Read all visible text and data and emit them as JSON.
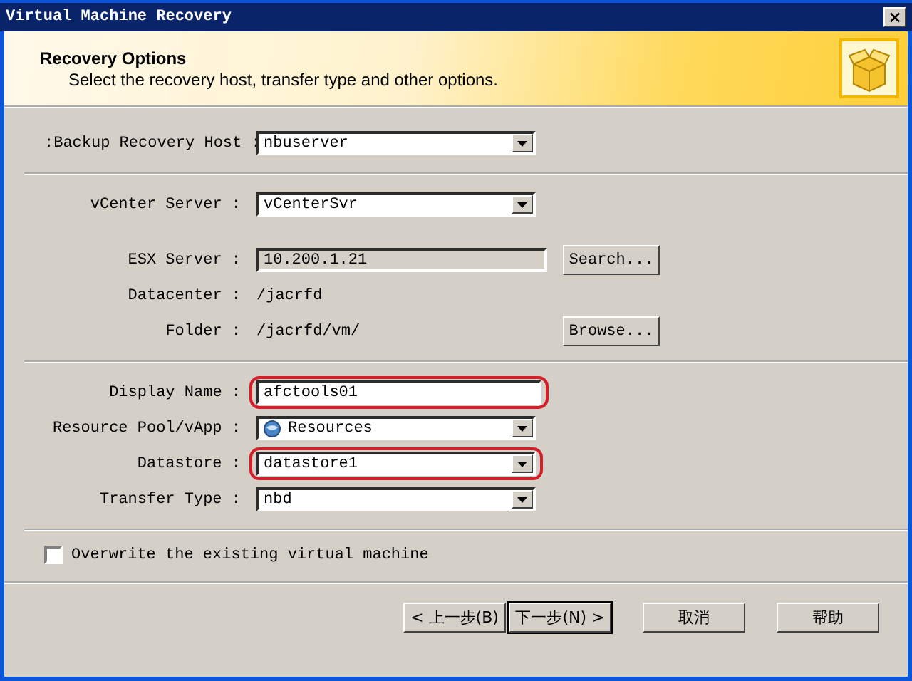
{
  "window": {
    "title": "Virtual Machine Recovery",
    "close": "×"
  },
  "header": {
    "title": "Recovery Options",
    "subtitle": "Select the recovery host, transfer type and other options."
  },
  "groups": [
    {
      "rows": [
        {
          "label": ":Backup Recovery Host :",
          "kind": "combo",
          "value": "nbuserver",
          "highlighted": false
        }
      ]
    },
    {
      "rows": [
        {
          "label": "vCenter Server :",
          "kind": "combo",
          "value": "vCenterSvr",
          "highlighted": false
        },
        {
          "kind": "gap"
        },
        {
          "label": "ESX Server :",
          "kind": "readonly",
          "value": "10.200.1.21",
          "button": "Search...",
          "highlighted": false
        },
        {
          "label": "Datacenter :",
          "kind": "static",
          "value": "/jacrfd",
          "highlighted": false
        },
        {
          "label": "Folder :",
          "kind": "static",
          "value": "/jacrfd/vm/",
          "button": "Browse...",
          "highlighted": false
        }
      ]
    },
    {
      "rows": [
        {
          "label": "Display Name :",
          "kind": "text",
          "value": "afctools01",
          "highlighted": true
        },
        {
          "label": "Resource Pool/vApp :",
          "kind": "icon-combo",
          "value": "Resources",
          "highlighted": false
        },
        {
          "label": "Datastore :",
          "kind": "combo",
          "value": "datastore1",
          "highlighted": true
        },
        {
          "label": "Transfer Type :",
          "kind": "combo",
          "value": "nbd",
          "highlighted": false
        }
      ]
    }
  ],
  "overwrite": {
    "label": "Overwrite the existing virtual machine",
    "checked": false
  },
  "buttons": [
    {
      "label": "< 上一步(B)",
      "default": false
    },
    {
      "label": "下一步(N) >",
      "default": true
    },
    {
      "label": "取消",
      "default": false
    },
    {
      "label": "帮助",
      "default": false
    }
  ]
}
